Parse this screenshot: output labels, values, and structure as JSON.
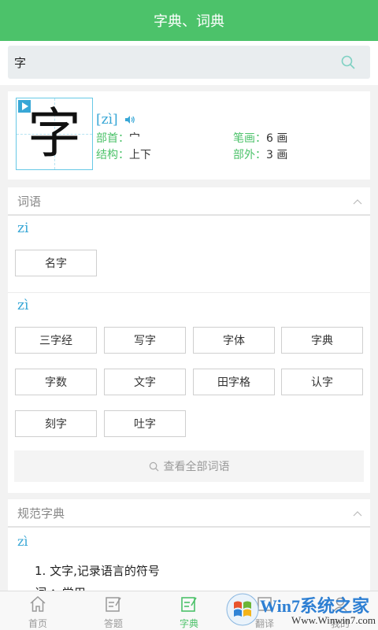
{
  "header": {
    "title": "字典、词典"
  },
  "search": {
    "value": "字"
  },
  "character": {
    "glyph": "字",
    "pinyin": "[zì]",
    "radical_label": "部首：",
    "radical_value": "宀",
    "strokes_label": "笔画：",
    "strokes_value": "6 画",
    "structure_label": "结构：",
    "structure_value": "上下",
    "extra_strokes_label": "部外：",
    "extra_strokes_value": "3 画"
  },
  "words": {
    "title": "词语",
    "groups": [
      {
        "pinyin": "zi",
        "items": [
          "名字"
        ]
      },
      {
        "pinyin": "zì",
        "items": [
          "三字经",
          "写字",
          "字体",
          "字典",
          "字数",
          "文字",
          "田字格",
          "认字",
          "刻字",
          "吐字"
        ]
      }
    ],
    "view_all_label": "查看全部词语"
  },
  "dictionary": {
    "title": "规范字典",
    "pinyin": "zì",
    "definitions": [
      "1. 文字,记录语言的符号",
      "词 ：常用"
    ]
  },
  "tabs": [
    {
      "label": "首页",
      "icon": "home-icon"
    },
    {
      "label": "答题",
      "icon": "edit-icon"
    },
    {
      "label": "字典",
      "icon": "dictionary-icon",
      "active": true
    },
    {
      "label": "翻译",
      "icon": "translate-icon"
    },
    {
      "label": "我的",
      "icon": "profile-icon"
    }
  ],
  "watermark": {
    "brand": "Win7系统之家",
    "url": "Www.Winwin7.com"
  }
}
